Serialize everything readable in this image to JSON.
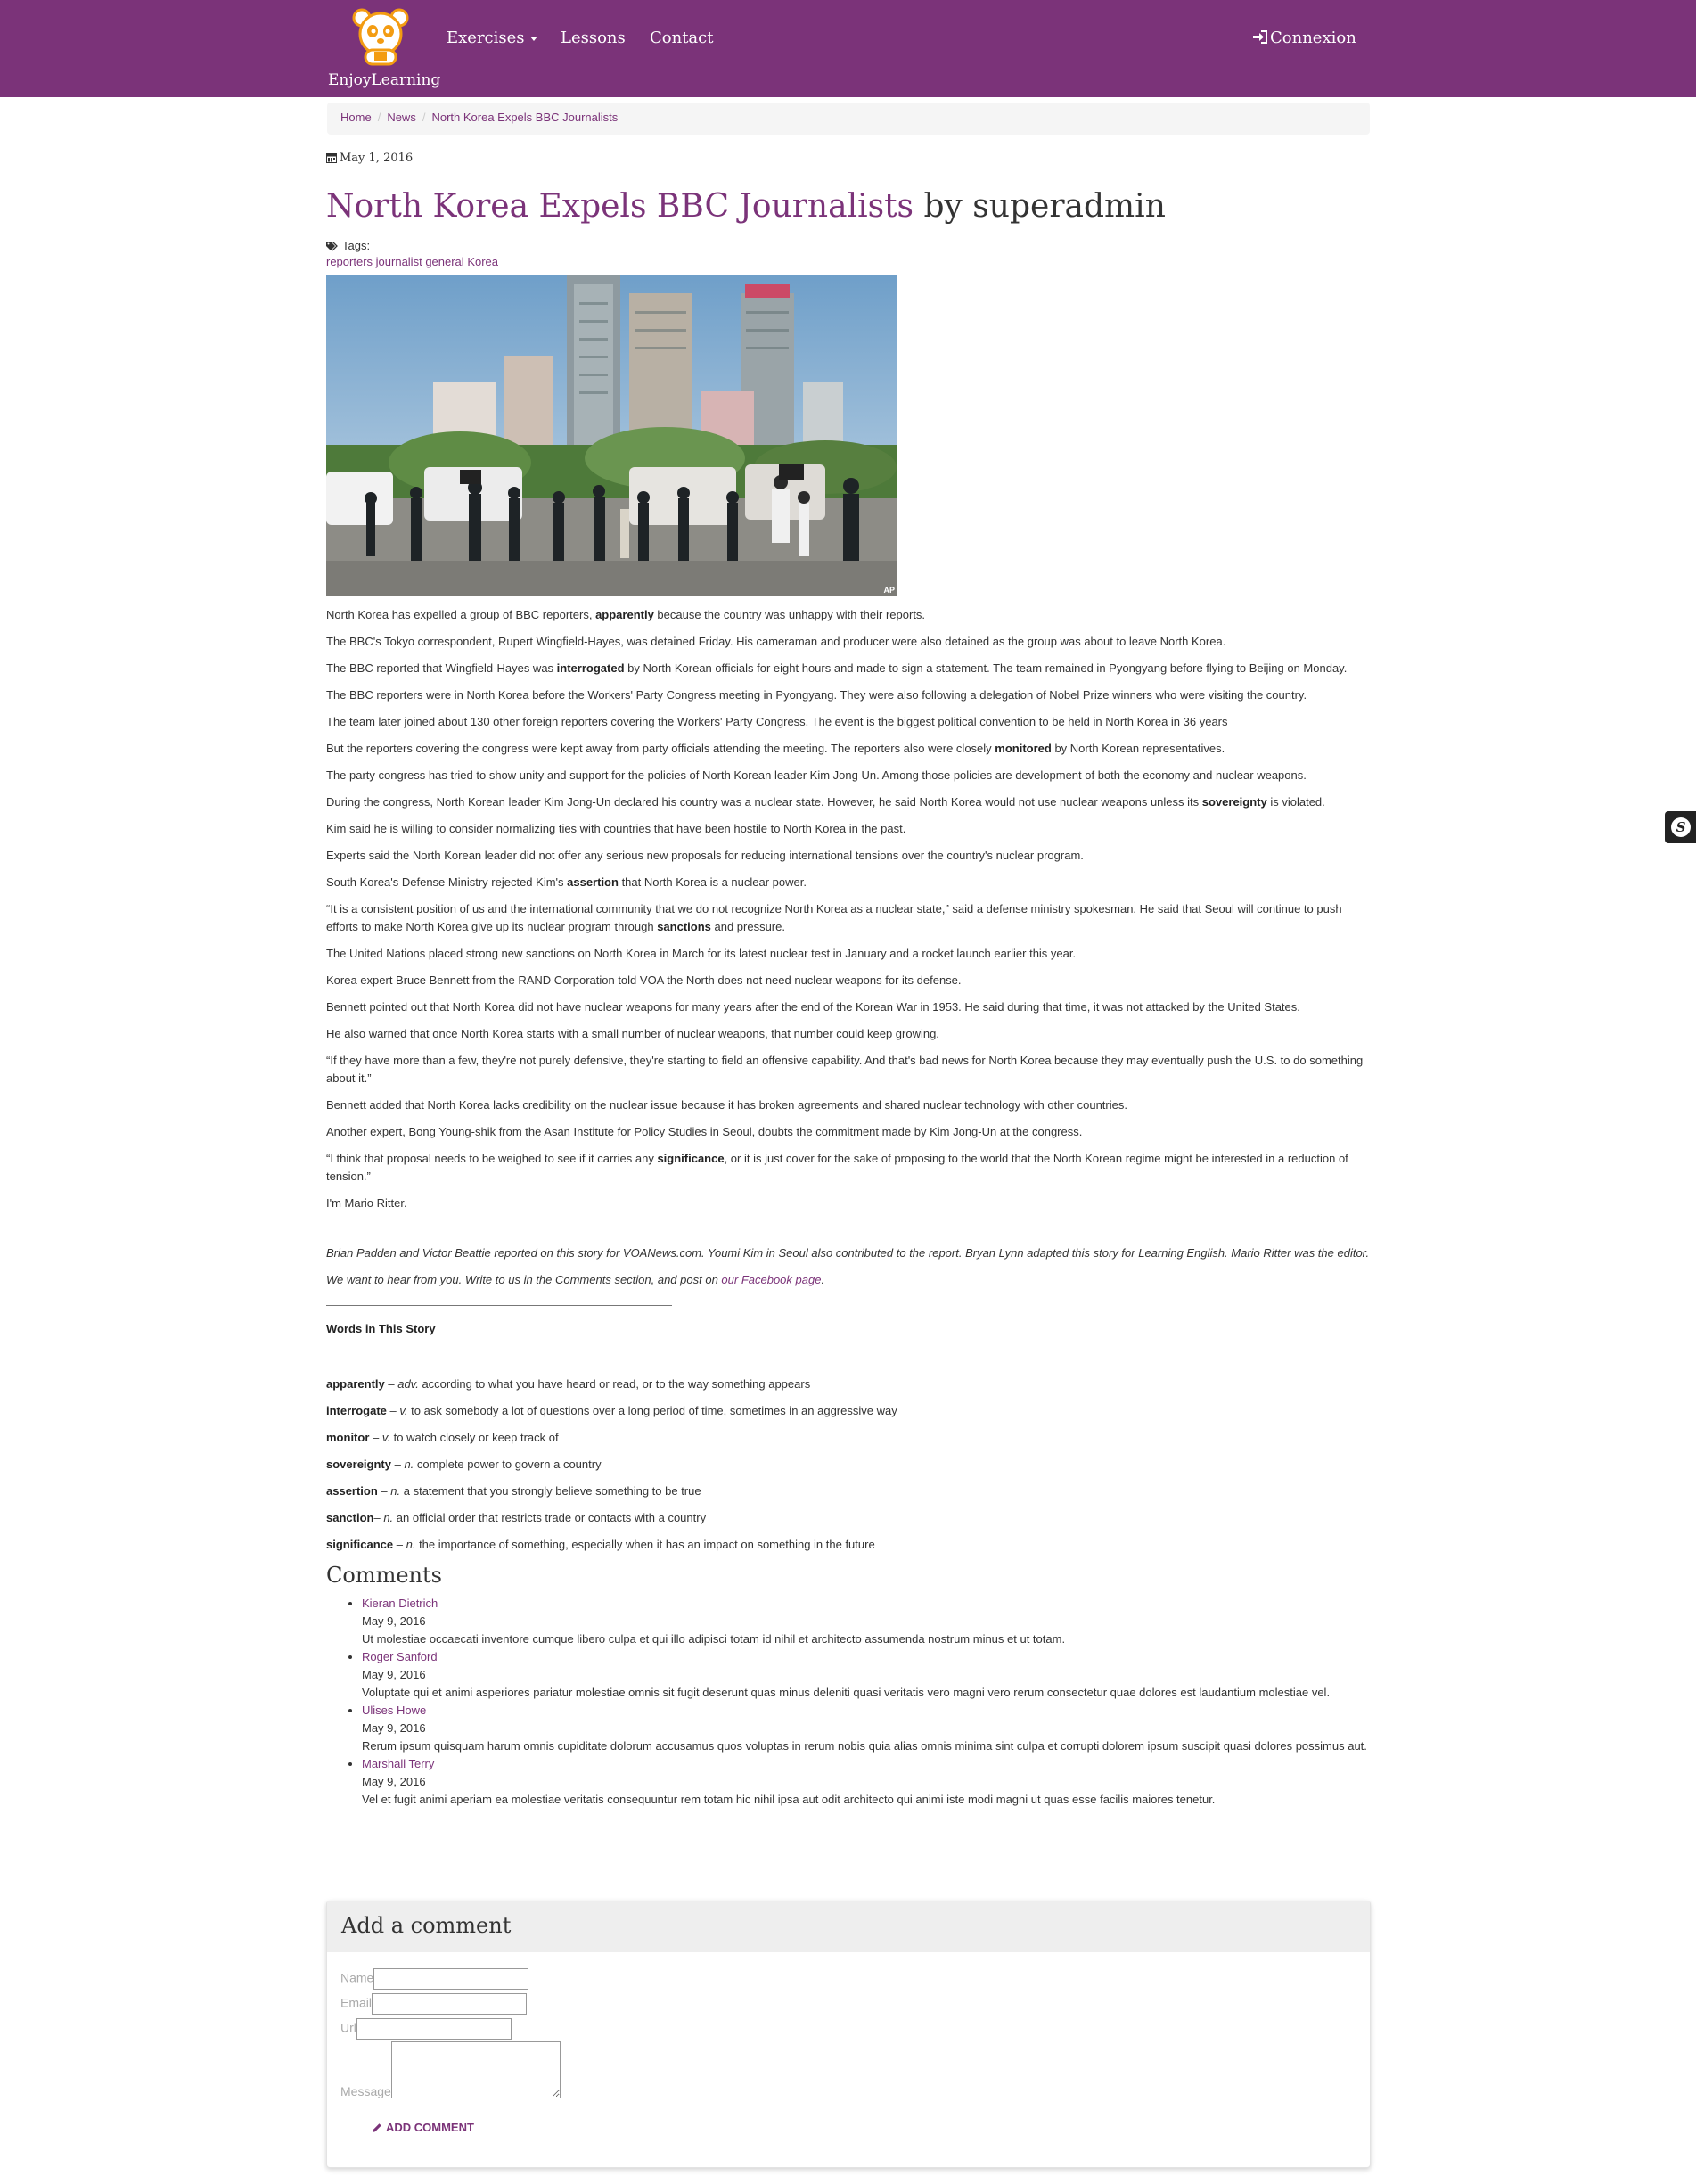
{
  "colors": {
    "brand": "#7b3379",
    "link": "#7b3379",
    "breadcrumb_bg": "#f5f5f5",
    "panel_heading_bg": "#eeeeee"
  },
  "nav": {
    "brand_name": "EnjoyLearning",
    "exercises": "Exercises",
    "lessons": "Lessons",
    "contact": "Contact",
    "login": "Connexion",
    "login_icon": "sign-in-icon",
    "logo_icon": "panda-logo-icon"
  },
  "breadcrumb": [
    "Home",
    "News",
    "North Korea Expels BBC Journalists"
  ],
  "article": {
    "date": "May 1, 2016",
    "title": "North Korea Expels BBC Journalists",
    "byline": "by superadmin",
    "tags_label": "Tags:",
    "tags": [
      "reporters",
      "journalist",
      "general",
      "Korea"
    ],
    "image_credit": "AP",
    "paragraphs": [
      [
        "North Korea has expelled a group of BBC reporters, ",
        "apparently",
        " because the country was unhappy with their reports."
      ],
      [
        "The BBC's Tokyo correspondent, Rupert Wingfield-Hayes, was detained Friday. His cameraman and producer were also detained as the group was about to leave North Korea.",
        "",
        ""
      ],
      [
        "The BBC reported that Wingfield-Hayes was ",
        "interrogated",
        " by North Korean officials for eight hours and made to sign a statement. The team remained in Pyongyang before flying to Beijing on Monday."
      ],
      [
        "The BBC reporters were in North Korea before the Workers' Party Congress meeting in Pyongyang. They were also following a delegation of Nobel Prize winners who were visiting the country.",
        "",
        ""
      ],
      [
        "The team later joined about 130 other foreign reporters covering the Workers' Party Congress. The event is the biggest political convention to be held in North Korea in 36 years",
        "",
        ""
      ],
      [
        "But the reporters covering the congress were kept away from party officials attending the meeting. The reporters also were closely ",
        "monitored",
        " by North Korean representatives."
      ],
      [
        "The party congress has tried to show unity and support for the policies of North Korean leader Kim Jong Un. Among those policies are development of both the economy and nuclear weapons.",
        "",
        ""
      ],
      [
        "During the congress, North Korean leader Kim Jong-Un declared his country was a nuclear state. However, he said North Korea would not use nuclear weapons unless its ",
        "sovereignty",
        " is violated."
      ],
      [
        "Kim said he is willing to consider normalizing ties with countries that have been hostile to North Korea in the past.",
        "",
        ""
      ],
      [
        "Experts said the North Korean leader did not offer any serious new proposals for reducing international tensions over the country's nuclear program.",
        "",
        ""
      ],
      [
        "South Korea's Defense Ministry rejected Kim's ",
        "assertion",
        " that North Korea is a nuclear power."
      ],
      [
        "“It is a consistent position of us and the international community that we do not recognize North Korea as a nuclear state,” said a defense ministry spokesman. He said that Seoul will continue to push efforts to make North Korea give up its nuclear program through ",
        "sanctions",
        " and pressure."
      ],
      [
        "The United Nations placed strong new sanctions on North Korea in March for its latest nuclear test in January and a rocket launch earlier this year.",
        "",
        ""
      ],
      [
        "Korea expert Bruce Bennett from the RAND Corporation told VOA the North does not need nuclear weapons for its defense.",
        "",
        ""
      ],
      [
        "Bennett pointed out that North Korea did not have nuclear weapons for many years after the end of the Korean War in 1953. He said during that time, it was not attacked by the United States.",
        "",
        ""
      ],
      [
        "He also warned that once North Korea starts with a small number of nuclear weapons, that number could keep growing.",
        "",
        ""
      ],
      [
        "“If they have more than a few, they're not purely defensive, they're starting to field an offensive capability. And that's bad news for North Korea because they may eventually push the U.S. to do something about it.”",
        "",
        ""
      ],
      [
        "Bennett added that North Korea lacks credibility on the nuclear issue because it has broken agreements and shared nuclear technology with other countries.",
        "",
        ""
      ],
      [
        "Another expert, Bong Young-shik from the Asan Institute for Policy Studies in Seoul, doubts the commitment made by Kim Jong-Un at the congress.",
        "",
        ""
      ],
      [
        "“I think that proposal needs to be weighed to see if it carries any ",
        "significance",
        ", or it is just cover for the sake of proposing to the world that the North Korean regime might be interested in a reduction of tension.”"
      ],
      [
        "I'm Mario Ritter.",
        "",
        ""
      ]
    ],
    "credits": "Brian Padden and Victor Beattie reported on this story for VOANews.com. Youmi Kim in Seoul also contributed to the report. Bryan Lynn adapted this story for Learning English. Mario Ritter was the editor.",
    "feedback_text": "We want to hear from you. Write to us in the Comments section, and post on ",
    "feedback_link": "our Facebook page",
    "feedback_end": "."
  },
  "words": {
    "title": "Words in This Story",
    "items": [
      {
        "word": "apparently",
        "sep": " – ",
        "pos": "adv.",
        "def": " according to what you have heard or read, or to the way something appears"
      },
      {
        "word": "interrogate",
        "sep": " – ",
        "pos": "v.",
        "def": " to ask somebody a lot of questions over a long period of time, sometimes in an aggressive way"
      },
      {
        "word": "monitor",
        "sep": " – ",
        "pos": "v.",
        "def": " to watch closely or keep track of"
      },
      {
        "word": "sovereignty",
        "sep": " – ",
        "pos": "n.",
        "def": " complete power to govern a country"
      },
      {
        "word": "assertion",
        "sep": " – ",
        "pos": "n.",
        "def": " a statement that you strongly believe something to be true"
      },
      {
        "word": "sanction",
        "sep": "– ",
        "pos": "n.",
        "def": " an official order that restricts trade or contacts with a country"
      },
      {
        "word": "significance",
        "sep": " – ",
        "pos": "n.",
        "def": " the importance of something, especially when it has an impact on something in the future"
      }
    ]
  },
  "comments": {
    "title": "Comments",
    "items": [
      {
        "author": "Kieran Dietrich",
        "date": "May 9, 2016",
        "text": "Ut molestiae occaecati inventore cumque libero culpa et qui illo adipisci totam id nihil et architecto assumenda nostrum minus et ut totam."
      },
      {
        "author": "Roger Sanford",
        "date": "May 9, 2016",
        "text": "Voluptate qui et animi asperiores pariatur molestiae omnis sit fugit deserunt quas minus deleniti quasi veritatis vero magni vero rerum consectetur quae dolores est laudantium molestiae vel."
      },
      {
        "author": "Ulises Howe",
        "date": "May 9, 2016",
        "text": "Rerum ipsum quisquam harum omnis cupiditate dolorum accusamus quos voluptas in rerum nobis quia alias omnis minima sint culpa et corrupti dolorem ipsum suscipit quasi dolores possimus aut."
      },
      {
        "author": "Marshall Terry",
        "date": "May 9, 2016",
        "text": "Vel et fugit animi aperiam ea molestiae veritatis consequuntur rem totam hic nihil ipsa aut odit architecto qui animi iste modi magni ut quas esse facilis maiores tenetur."
      }
    ]
  },
  "form": {
    "heading": "Add a comment",
    "name_label": "Name",
    "email_label": "Email",
    "url_label": "Url",
    "message_label": "Message",
    "name_value": "",
    "email_value": "",
    "url_value": "",
    "message_value": "",
    "submit_label": "Add comment"
  },
  "side_widget": {
    "glyph": "S",
    "icon": "symfony-icon"
  }
}
